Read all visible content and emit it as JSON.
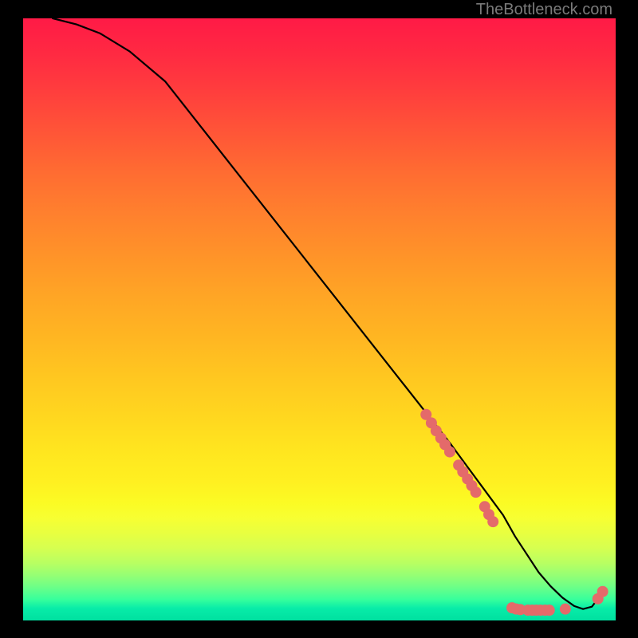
{
  "watermark": "TheBottleneck.com",
  "chart_data": {
    "type": "line",
    "title": "",
    "xlabel": "",
    "ylabel": "",
    "xlim": [
      0,
      100
    ],
    "ylim": [
      0,
      100
    ],
    "grid": false,
    "series": [
      {
        "name": "curve",
        "x": [
          5,
          9,
          13,
          18,
          24,
          30,
          36,
          42,
          48,
          54,
          60,
          64,
          68,
          72,
          75,
          78,
          81,
          83,
          85,
          87,
          89,
          91,
          93,
          94.5,
          96,
          97,
          98
        ],
        "y": [
          100,
          99,
          97.5,
          94.5,
          89.5,
          82,
          74.5,
          67,
          59.5,
          52,
          44.5,
          39.5,
          34.5,
          29.5,
          25.5,
          21.5,
          17.5,
          14,
          11,
          8,
          5.7,
          3.8,
          2.4,
          1.9,
          2.3,
          3.6,
          5.4
        ]
      }
    ],
    "markers": [
      {
        "x": 68.0,
        "y": 34.2
      },
      {
        "x": 68.9,
        "y": 32.8
      },
      {
        "x": 69.7,
        "y": 31.5
      },
      {
        "x": 70.5,
        "y": 30.3
      },
      {
        "x": 71.2,
        "y": 29.2
      },
      {
        "x": 72.0,
        "y": 28.0
      },
      {
        "x": 73.5,
        "y": 25.8
      },
      {
        "x": 74.2,
        "y": 24.7
      },
      {
        "x": 75.0,
        "y": 23.5
      },
      {
        "x": 75.7,
        "y": 22.4
      },
      {
        "x": 76.4,
        "y": 21.3
      },
      {
        "x": 77.9,
        "y": 18.9
      },
      {
        "x": 78.6,
        "y": 17.6
      },
      {
        "x": 79.3,
        "y": 16.4
      },
      {
        "x": 82.5,
        "y": 2.1
      },
      {
        "x": 83.2,
        "y": 1.9
      },
      {
        "x": 83.9,
        "y": 1.8
      },
      {
        "x": 85.2,
        "y": 1.7
      },
      {
        "x": 85.9,
        "y": 1.7
      },
      {
        "x": 86.6,
        "y": 1.7
      },
      {
        "x": 87.3,
        "y": 1.7
      },
      {
        "x": 88.1,
        "y": 1.7
      },
      {
        "x": 88.8,
        "y": 1.7
      },
      {
        "x": 91.5,
        "y": 1.9
      },
      {
        "x": 97.0,
        "y": 3.6
      },
      {
        "x": 97.8,
        "y": 4.8
      }
    ],
    "marker_color": "#e46a6a",
    "line_color": "#000000"
  }
}
